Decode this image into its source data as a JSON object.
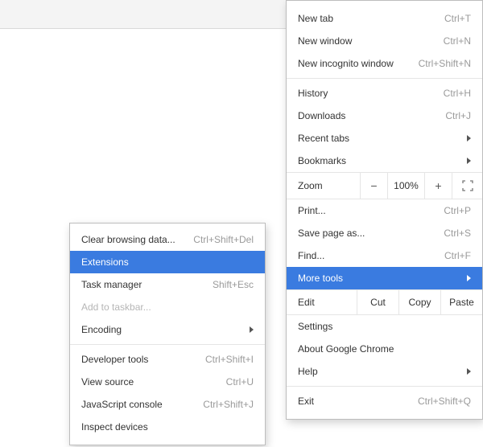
{
  "main_menu": {
    "new_tab": {
      "label": "New tab",
      "shortcut": "Ctrl+T"
    },
    "new_window": {
      "label": "New window",
      "shortcut": "Ctrl+N"
    },
    "new_incognito": {
      "label": "New incognito window",
      "shortcut": "Ctrl+Shift+N"
    },
    "history": {
      "label": "History",
      "shortcut": "Ctrl+H"
    },
    "downloads": {
      "label": "Downloads",
      "shortcut": "Ctrl+J"
    },
    "recent_tabs": {
      "label": "Recent tabs"
    },
    "bookmarks": {
      "label": "Bookmarks"
    },
    "zoom": {
      "label": "Zoom",
      "minus": "−",
      "value": "100%",
      "plus": "+"
    },
    "print": {
      "label": "Print...",
      "shortcut": "Ctrl+P"
    },
    "save_as": {
      "label": "Save page as...",
      "shortcut": "Ctrl+S"
    },
    "find": {
      "label": "Find...",
      "shortcut": "Ctrl+F"
    },
    "more_tools": {
      "label": "More tools"
    },
    "edit": {
      "label": "Edit",
      "cut": "Cut",
      "copy": "Copy",
      "paste": "Paste"
    },
    "settings": {
      "label": "Settings"
    },
    "about": {
      "label": "About Google Chrome"
    },
    "help": {
      "label": "Help"
    },
    "exit": {
      "label": "Exit",
      "shortcut": "Ctrl+Shift+Q"
    }
  },
  "sub_menu": {
    "clear_browsing": {
      "label": "Clear browsing data...",
      "shortcut": "Ctrl+Shift+Del"
    },
    "extensions": {
      "label": "Extensions"
    },
    "task_manager": {
      "label": "Task manager",
      "shortcut": "Shift+Esc"
    },
    "add_to_taskbar": {
      "label": "Add to taskbar..."
    },
    "encoding": {
      "label": "Encoding"
    },
    "developer_tools": {
      "label": "Developer tools",
      "shortcut": "Ctrl+Shift+I"
    },
    "view_source": {
      "label": "View source",
      "shortcut": "Ctrl+U"
    },
    "js_console": {
      "label": "JavaScript console",
      "shortcut": "Ctrl+Shift+J"
    },
    "inspect_devices": {
      "label": "Inspect devices"
    }
  }
}
